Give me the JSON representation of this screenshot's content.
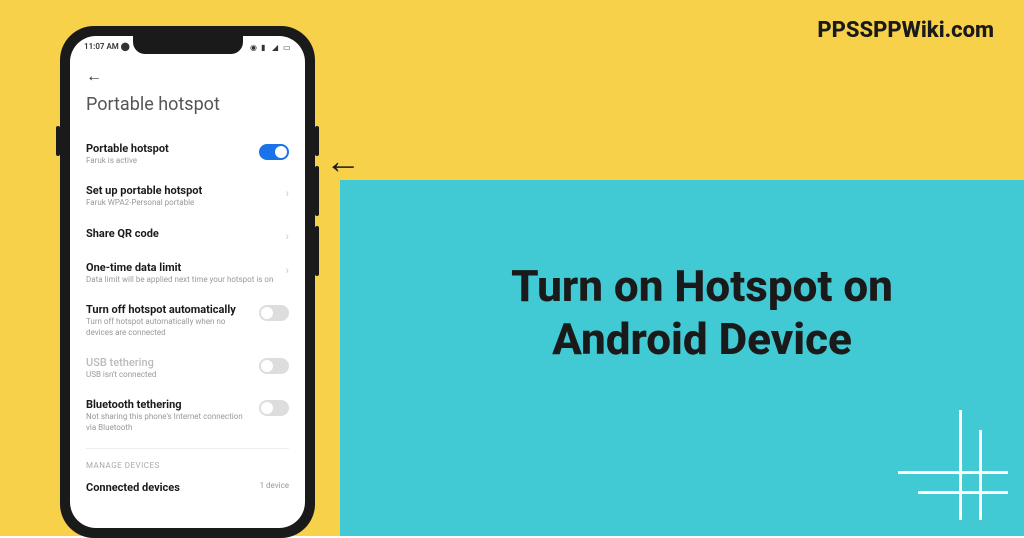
{
  "logo": "PPSSPPWiki.com",
  "mainText": "Turn on Hotspot on Android Device",
  "statusBar": {
    "time": "11:07 AM"
  },
  "page": {
    "title": "Portable hotspot"
  },
  "settings": {
    "portableHotspot": {
      "title": "Portable hotspot",
      "sub": "Faruk is active"
    },
    "setup": {
      "title": "Set up portable hotspot",
      "sub": "Faruk WPA2-Personal portable"
    },
    "shareQr": {
      "title": "Share QR code"
    },
    "dataLimit": {
      "title": "One-time data limit",
      "sub": "Data limit will be applied next time your hotspot is on"
    },
    "autoOff": {
      "title": "Turn off hotspot automatically",
      "sub": "Turn off hotspot automatically when no devices are connected"
    },
    "usb": {
      "title": "USB tethering",
      "sub": "USB isn't connected"
    },
    "bluetooth": {
      "title": "Bluetooth tethering",
      "sub": "Not sharing this phone's Internet connection via Bluetooth"
    },
    "manageLabel": "MANAGE DEVICES",
    "connected": {
      "title": "Connected devices",
      "count": "1 device"
    }
  }
}
